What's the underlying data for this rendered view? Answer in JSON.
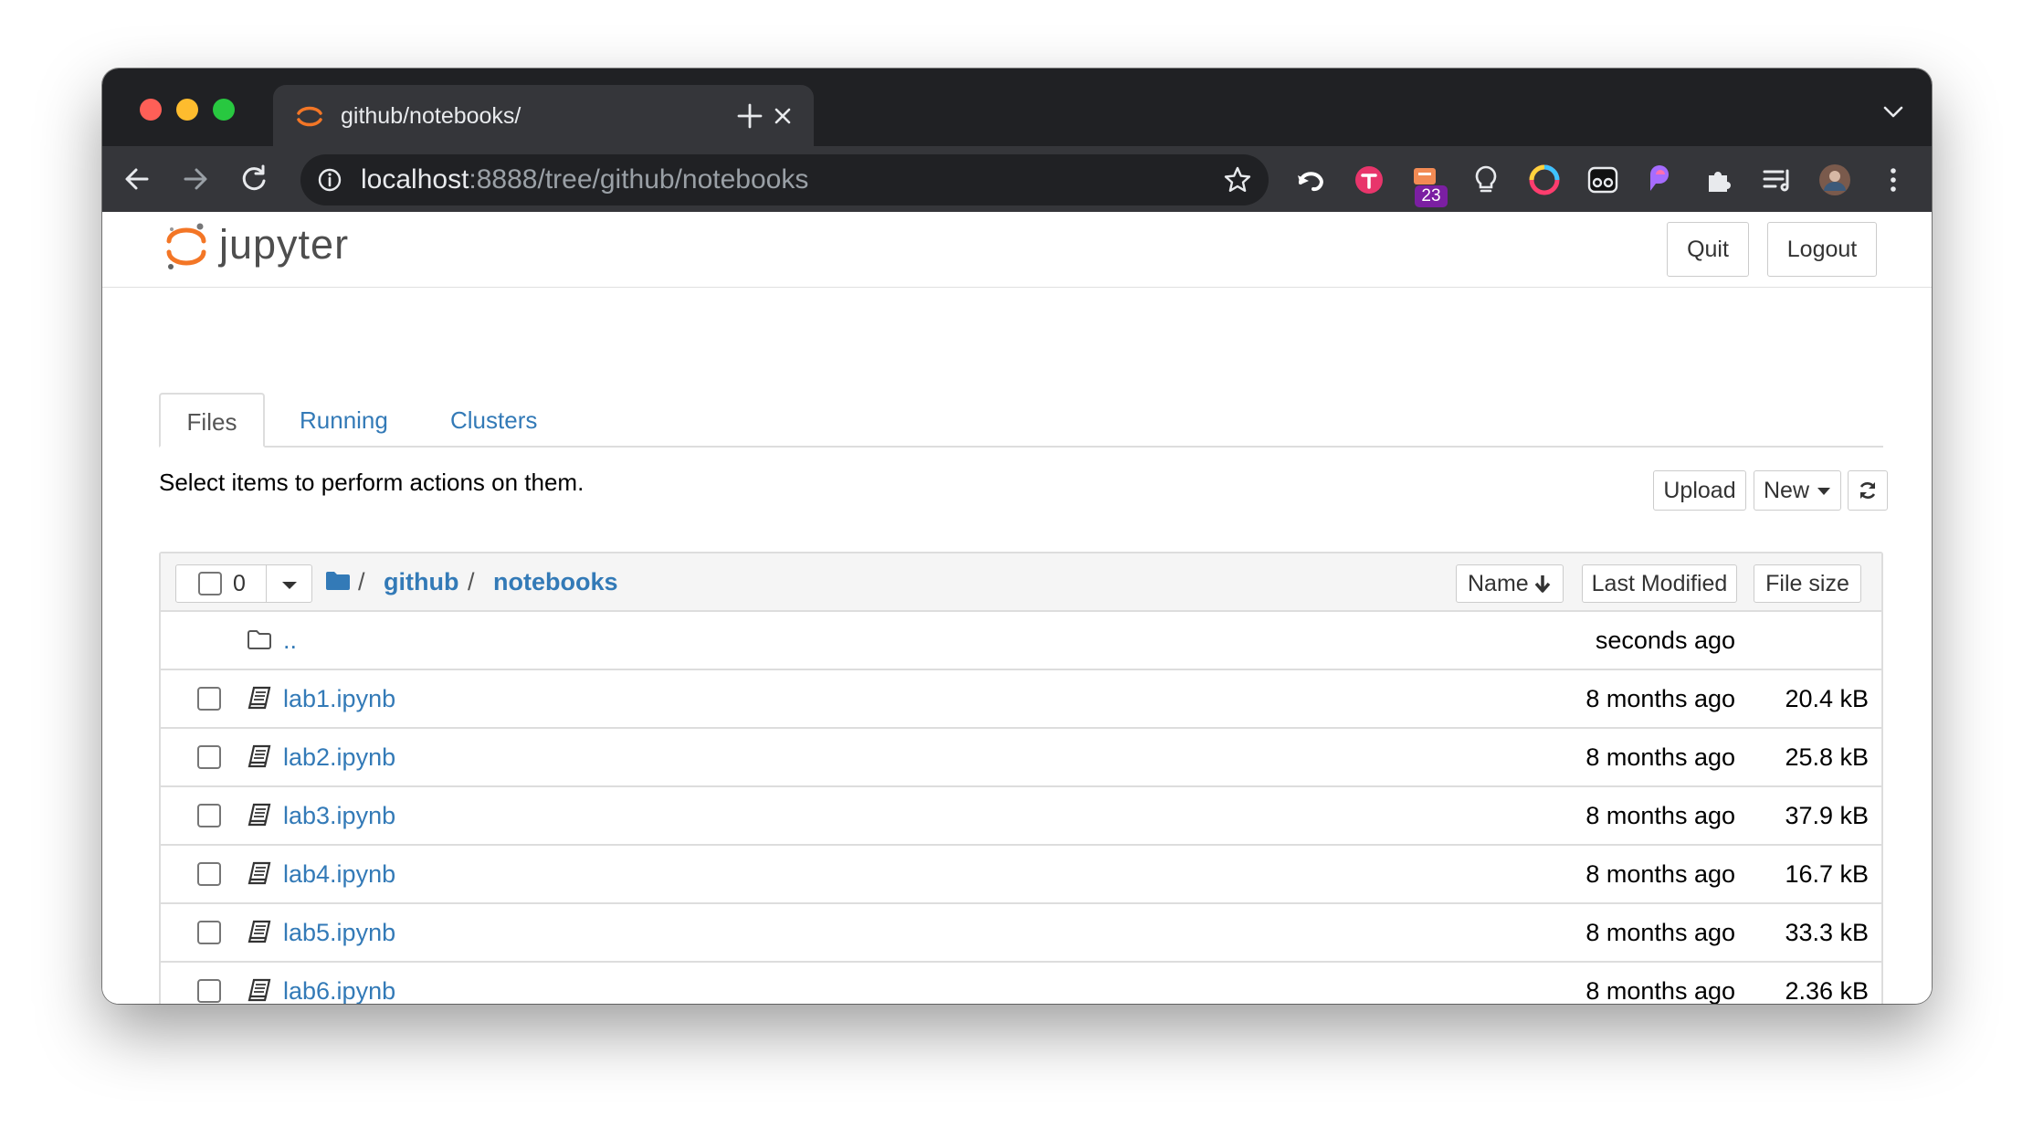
{
  "browser": {
    "tab_title": "github/notebooks/",
    "url_host": "localhost",
    "url_path": ":8888/tree/github/notebooks",
    "extension_badge": "23"
  },
  "jupyter": {
    "logo_text": "jupyter",
    "quit_label": "Quit",
    "logout_label": "Logout",
    "tabs": [
      "Files",
      "Running",
      "Clusters"
    ],
    "instructions": "Select items to perform actions on them.",
    "upload_label": "Upload",
    "new_label": "New",
    "selected_count": "0",
    "breadcrumb": [
      "github",
      "notebooks"
    ],
    "columns": {
      "name": "Name",
      "last_modified": "Last Modified",
      "file_size": "File size"
    },
    "parent_dir": {
      "name": "..",
      "modified": "seconds ago"
    },
    "files": [
      {
        "name": "lab1.ipynb",
        "modified": "8 months ago",
        "size": "20.4 kB"
      },
      {
        "name": "lab2.ipynb",
        "modified": "8 months ago",
        "size": "25.8 kB"
      },
      {
        "name": "lab3.ipynb",
        "modified": "8 months ago",
        "size": "37.9 kB"
      },
      {
        "name": "lab4.ipynb",
        "modified": "8 months ago",
        "size": "16.7 kB"
      },
      {
        "name": "lab5.ipynb",
        "modified": "8 months ago",
        "size": "33.3 kB"
      },
      {
        "name": "lab6.ipynb",
        "modified": "8 months ago",
        "size": "2.36 kB"
      }
    ]
  },
  "colors": {
    "link": "#337ab7",
    "jupyter_orange": "#f37626",
    "chrome_dark": "#202124",
    "chrome_toolbar": "#35363a"
  }
}
